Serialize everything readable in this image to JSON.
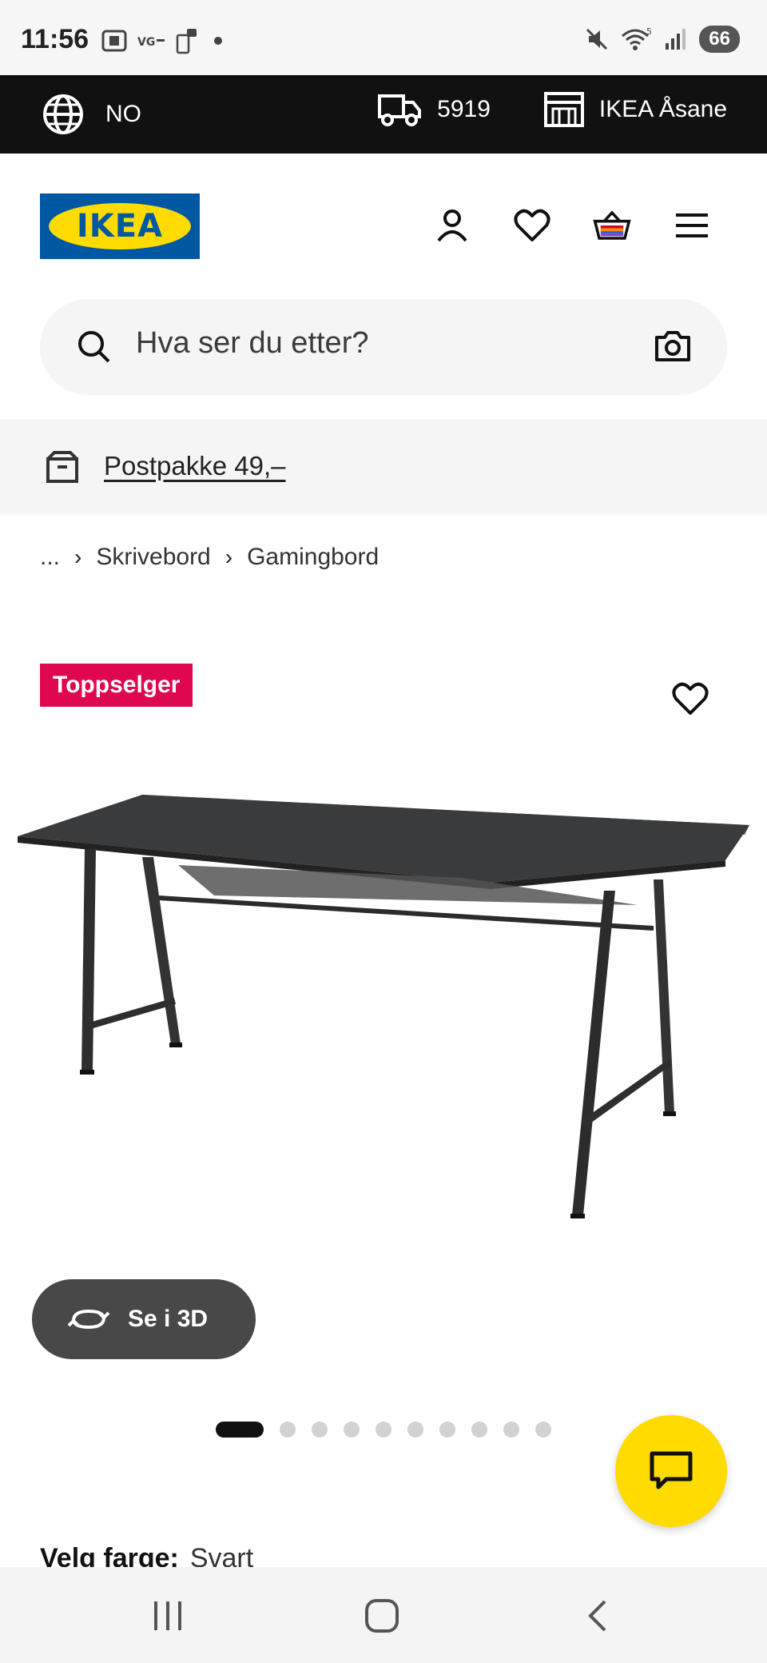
{
  "status_bar": {
    "time": "11:56",
    "battery": "66",
    "signal_label": "5"
  },
  "top_strip": {
    "language": "NO",
    "delivery_code": "5919",
    "store": "IKEA Åsane"
  },
  "header": {
    "logo_text": "IKEA",
    "brand_colors": {
      "blue": "#0058a3",
      "yellow": "#ffdb00"
    },
    "icons": [
      "user-icon",
      "heart-icon",
      "shopping-bag-icon",
      "hamburger-menu-icon"
    ]
  },
  "search": {
    "placeholder": "Hva ser du etter?"
  },
  "promo": {
    "label": "Postpakke 49,–"
  },
  "breadcrumb": {
    "ellipsis": "...",
    "items": [
      "Skrivebord",
      "Gamingbord"
    ]
  },
  "product": {
    "badge": "Toppselger",
    "badge_color": "#e00751",
    "view_3d_label": "Se i 3D",
    "image_count": 10,
    "active_image": 1,
    "color_label": "Velg farge:",
    "color_value": "Svart"
  },
  "chat": {
    "icon": "chat-icon",
    "color": "#ffdb00"
  },
  "nav": {
    "buttons": [
      "recents-button",
      "home-button",
      "back-button"
    ]
  }
}
